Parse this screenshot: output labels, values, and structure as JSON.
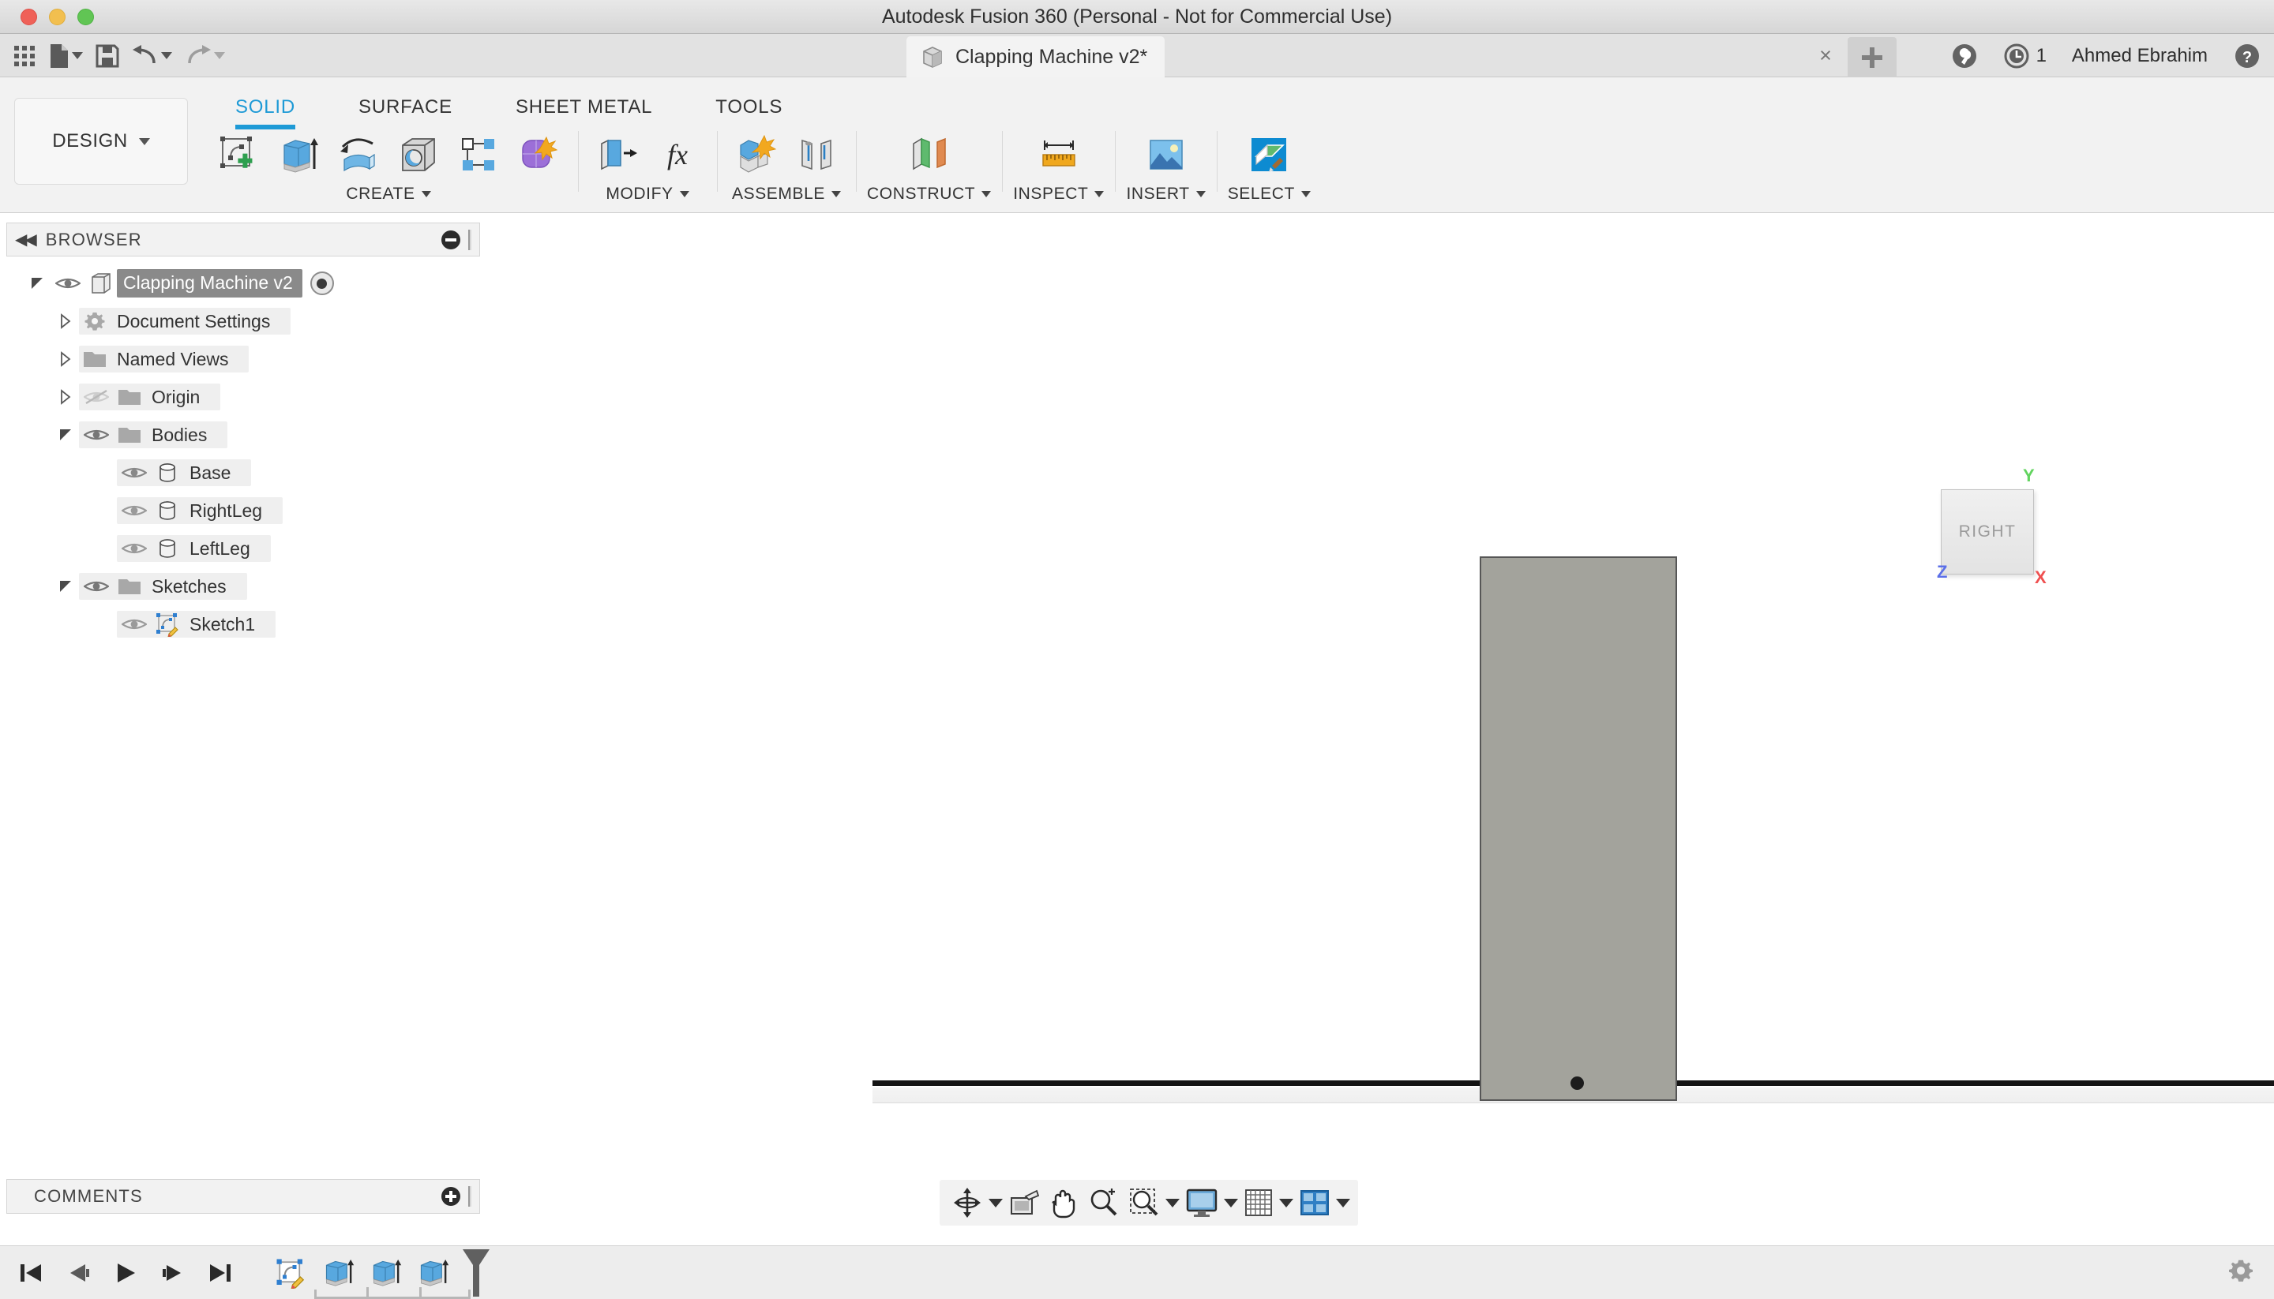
{
  "window": {
    "title": "Autodesk Fusion 360 (Personal - Not for Commercial Use)",
    "traffic_lights": [
      "close",
      "minimize",
      "zoom"
    ]
  },
  "quick_access": {
    "items": [
      {
        "name": "app-grid",
        "icon": "grid-icon",
        "label": ""
      },
      {
        "name": "new-file",
        "icon": "file-icon",
        "label": "",
        "has_caret": true
      },
      {
        "name": "save",
        "icon": "save-icon",
        "label": ""
      },
      {
        "name": "undo",
        "icon": "undo-icon",
        "label": "",
        "has_caret": true
      },
      {
        "name": "redo",
        "icon": "redo-icon",
        "label": "",
        "has_caret": true,
        "dim": true
      }
    ]
  },
  "document_tab": {
    "label": "Clapping Machine v2*",
    "icon": "cube-icon",
    "close_label": "×",
    "new_tab_label": "+"
  },
  "account_strip": {
    "job_status_icon": "wrench-icon",
    "notification_icon": "clock-icon",
    "notification_count": "1",
    "user_name": "Ahmed Ebrahim",
    "help_icon": "help-icon"
  },
  "workspace": {
    "selector_label": "DESIGN",
    "tabs": [
      {
        "label": "SOLID",
        "active": true
      },
      {
        "label": "SURFACE",
        "active": false
      },
      {
        "label": "SHEET METAL",
        "active": false
      },
      {
        "label": "TOOLS",
        "active": false
      }
    ],
    "accent_color": "#1e9ad6"
  },
  "ribbon_groups": [
    {
      "label": "CREATE",
      "tools": [
        {
          "name": "create-sketch",
          "icon": "sketch-plus-icon"
        },
        {
          "name": "extrude",
          "icon": "extrude-icon"
        },
        {
          "name": "revolve",
          "icon": "revolve-icon"
        },
        {
          "name": "hole",
          "icon": "hole-icon"
        },
        {
          "name": "pattern",
          "icon": "pattern-icon"
        },
        {
          "name": "create-form",
          "icon": "form-icon"
        }
      ]
    },
    {
      "label": "MODIFY",
      "tools": [
        {
          "name": "press-pull",
          "icon": "press-pull-icon"
        },
        {
          "name": "change-parameters",
          "icon": "fx-icon"
        }
      ]
    },
    {
      "label": "ASSEMBLE",
      "tools": [
        {
          "name": "new-component",
          "icon": "new-component-icon"
        },
        {
          "name": "joint",
          "icon": "joint-icon"
        }
      ]
    },
    {
      "label": "CONSTRUCT",
      "tools": [
        {
          "name": "offset-plane",
          "icon": "plane-icon"
        }
      ]
    },
    {
      "label": "INSPECT",
      "tools": [
        {
          "name": "measure",
          "icon": "ruler-icon"
        }
      ]
    },
    {
      "label": "INSERT",
      "tools": [
        {
          "name": "insert-image",
          "icon": "image-icon"
        }
      ]
    },
    {
      "label": "SELECT",
      "tools": [
        {
          "name": "select",
          "icon": "select-icon"
        }
      ]
    }
  ],
  "browser": {
    "title": "BROWSER",
    "collapse_label": "◀◀",
    "tree": [
      {
        "label": "Clapping Machine v2",
        "icon": "component-icon",
        "indent": 0,
        "twisty": "open",
        "eye": "visible",
        "selected": true,
        "radio": true
      },
      {
        "label": "Document Settings",
        "icon": "gear-icon",
        "indent": 1,
        "twisty": "closed",
        "eye": "none",
        "selected": false,
        "radio": false
      },
      {
        "label": "Named Views",
        "icon": "folder-icon",
        "indent": 1,
        "twisty": "closed",
        "eye": "none",
        "selected": false,
        "radio": false
      },
      {
        "label": "Origin",
        "icon": "folder-icon",
        "indent": 1,
        "twisty": "closed",
        "eye": "hidden",
        "selected": false,
        "radio": false
      },
      {
        "label": "Bodies",
        "icon": "folder-icon",
        "indent": 1,
        "twisty": "open",
        "eye": "visible",
        "selected": false,
        "radio": false
      },
      {
        "label": "Base",
        "icon": "body-icon",
        "indent": 2,
        "twisty": "none",
        "eye": "visible",
        "selected": false,
        "radio": false
      },
      {
        "label": "RightLeg",
        "icon": "body-icon",
        "indent": 2,
        "twisty": "none",
        "eye": "visible",
        "selected": false,
        "radio": false
      },
      {
        "label": "LeftLeg",
        "icon": "body-icon",
        "indent": 2,
        "twisty": "none",
        "eye": "visible",
        "selected": false,
        "radio": false
      },
      {
        "label": "Sketches",
        "icon": "folder-icon",
        "indent": 1,
        "twisty": "open",
        "eye": "visible",
        "selected": false,
        "radio": false
      },
      {
        "label": "Sketch1",
        "icon": "sketch-icon",
        "indent": 2,
        "twisty": "none",
        "eye": "visible",
        "selected": false,
        "radio": false
      }
    ]
  },
  "comments": {
    "title": "COMMENTS",
    "add_label": "+"
  },
  "viewport": {
    "view_cube_label": "RIGHT",
    "axis_labels": {
      "x": "X",
      "y": "Y",
      "z": "Z"
    },
    "axis_colors": {
      "x": "#ef5050",
      "y": "#62d45f",
      "z": "#5b6fe8"
    },
    "body_color": "#a3a39c",
    "background_color": "#ffffff"
  },
  "nav_bar": {
    "items": [
      {
        "name": "orbit",
        "icon": "orbit-icon",
        "has_caret": true
      },
      {
        "name": "look-at",
        "icon": "look-at-icon",
        "has_caret": false
      },
      {
        "name": "pan",
        "icon": "hand-icon",
        "has_caret": false
      },
      {
        "name": "zoom",
        "icon": "magnifier-plus-icon",
        "has_caret": false
      },
      {
        "name": "fit",
        "icon": "zoom-window-icon",
        "has_caret": true
      },
      {
        "name": "display-settings",
        "icon": "monitor-icon",
        "has_caret": true
      },
      {
        "name": "grid-settings",
        "icon": "grid-settings-icon",
        "has_caret": true
      },
      {
        "name": "viewports",
        "icon": "viewports-icon",
        "has_caret": true
      }
    ]
  },
  "timeline": {
    "controls": [
      {
        "name": "go-to-beginning",
        "icon": "skip-start-icon"
      },
      {
        "name": "step-back",
        "icon": "step-back-icon"
      },
      {
        "name": "play",
        "icon": "play-icon"
      },
      {
        "name": "step-forward",
        "icon": "step-forward-icon"
      },
      {
        "name": "go-to-end",
        "icon": "skip-end-icon"
      }
    ],
    "features": [
      {
        "name": "timeline-sketch1",
        "icon": "sketch-icon",
        "label": "Sketch1"
      },
      {
        "name": "timeline-extrude1",
        "icon": "extrude-icon",
        "label": "Extrude1"
      },
      {
        "name": "timeline-extrude2",
        "icon": "extrude-icon",
        "label": "Extrude2"
      },
      {
        "name": "timeline-extrude3",
        "icon": "extrude-icon",
        "label": "Extrude3"
      }
    ],
    "settings_icon": "gear-icon"
  }
}
